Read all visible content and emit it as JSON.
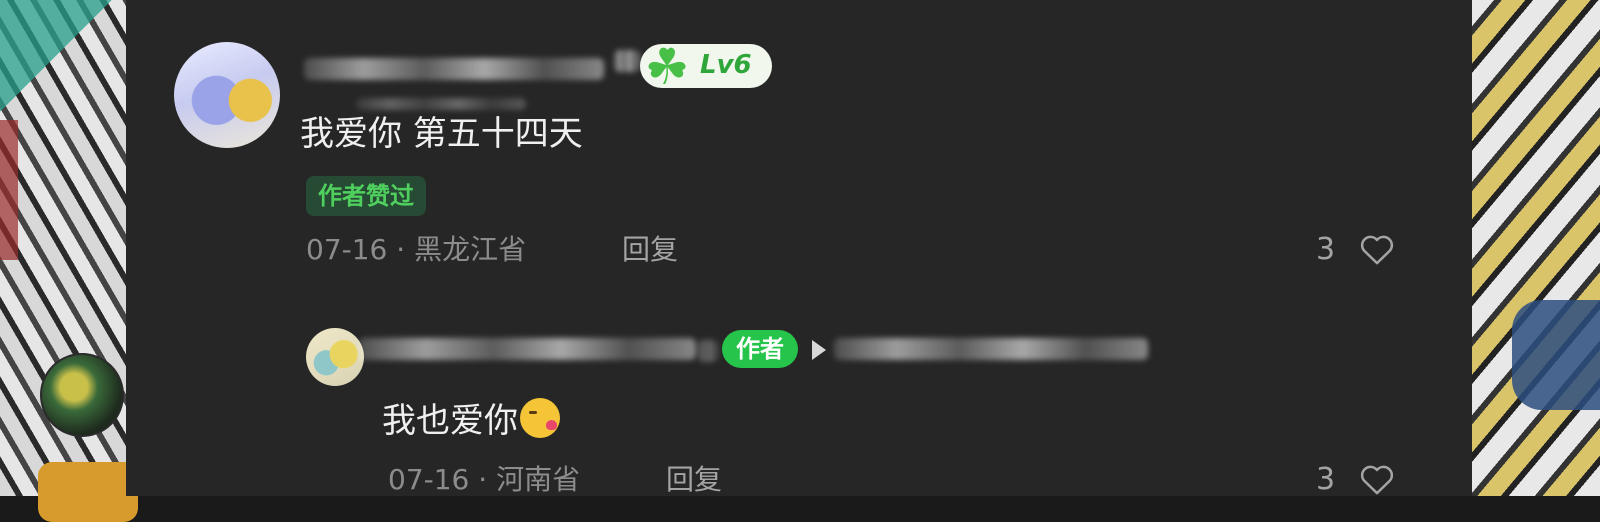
{
  "comment": {
    "level_badge": "Lv6",
    "text": "我爱你 第五十四天",
    "liked_by_author_tag": "作者赞过",
    "date": "07-16",
    "separator": " · ",
    "location": "黑龙江省",
    "reply_label": "回复",
    "like_count": "3"
  },
  "reply": {
    "author_badge": "作者",
    "text": "我也爱你",
    "emoji": "kissing-face-with-heart",
    "date": "07-16",
    "separator": " · ",
    "location": "河南省",
    "reply_label": "回复",
    "like_count": "3"
  },
  "colors": {
    "panel_bg": "#262626",
    "accent_green": "#26c44a",
    "meta_gray": "#8c8c8c"
  }
}
